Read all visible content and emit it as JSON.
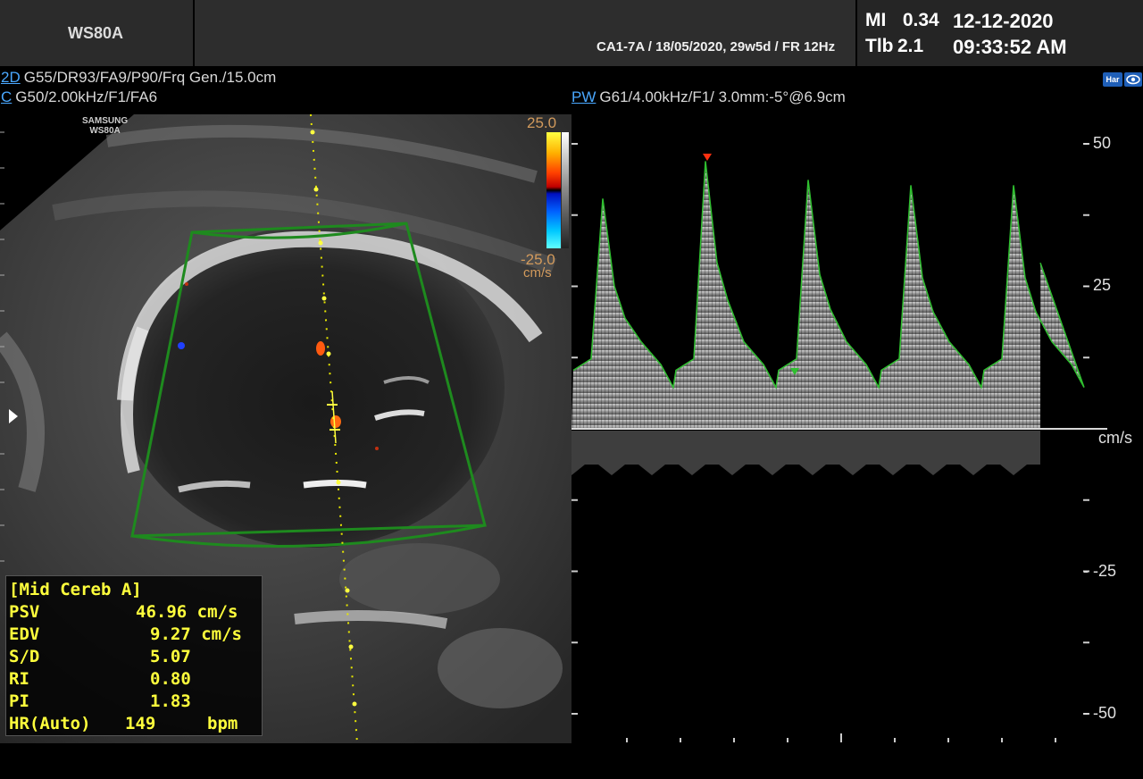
{
  "header": {
    "model": "WS80A",
    "patient_info": "CA1-7A / 18/05/2020, 29w5d / FR 12Hz",
    "mi_label": "MI",
    "mi_value": "0.34",
    "tib_label": "Tlb",
    "tib_value": "2.1",
    "date": "12-12-2020",
    "time": "09:33:52 AM"
  },
  "modes": {
    "bmode_tag": "2D",
    "bmode_params": "G55/DR93/FA9/P90/Frq Gen./15.0cm",
    "color_tag": "C",
    "color_params": "G50/2.00kHz/F1/FA6",
    "pw_tag": "PW",
    "pw_params": "G61/4.00kHz/F1/ 3.0mm:-5°@6.9cm"
  },
  "icons": {
    "harmonic": "Har",
    "harmonic_icon": "harmonic-icon",
    "view_icon": "eye-icon"
  },
  "image": {
    "watermark_line1": "SAMSUNG",
    "watermark_line2": "WS80A",
    "colorbar_top": "25.0",
    "colorbar_bottom": "-25.0",
    "colorbar_unit": "cm/s"
  },
  "measurements": {
    "title": "[Mid Cereb A]",
    "rows": [
      {
        "label": "PSV",
        "value": "46.96 cm/s"
      },
      {
        "label": "EDV",
        "value": "9.27 cm/s"
      },
      {
        "label": "S/D",
        "value": "5.07"
      },
      {
        "label": "RI",
        "value": "0.80"
      },
      {
        "label": "PI",
        "value": "1.83"
      }
    ],
    "hr_label": "HR(Auto)",
    "hr_value": "149",
    "hr_unit": "bpm"
  },
  "spectrum": {
    "axis_labels": [
      "- 50",
      "- 25",
      "- -25",
      "- -50"
    ],
    "unit": "cm/s",
    "velocity_ticks": [
      50,
      25,
      -25,
      -50
    ],
    "baseline": 0,
    "peak_velocity": 46.96,
    "end_diastolic_velocity": 9.27
  },
  "colors": {
    "mode_tag": "#4aa8ff",
    "trace": "#2fbf2f",
    "measurement_text": "#ffff3c",
    "colorbar_label": "#d29a5c"
  }
}
